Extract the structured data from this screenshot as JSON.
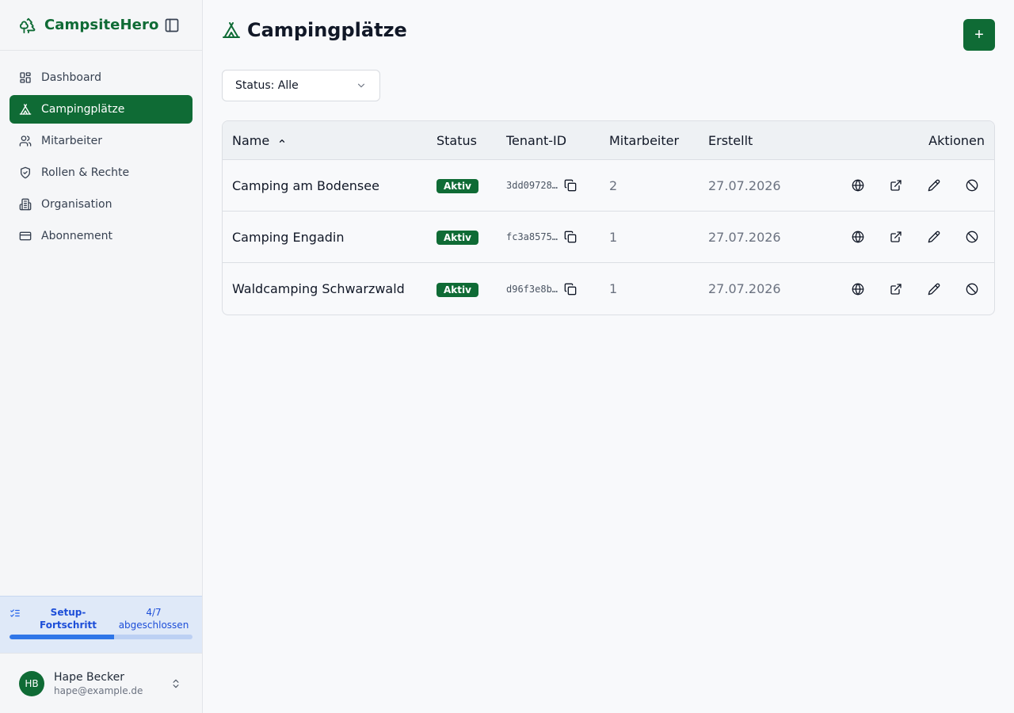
{
  "brand": {
    "name": "CampsiteHero"
  },
  "nav": [
    {
      "label": "Dashboard",
      "icon": "dashboard-icon",
      "active": false
    },
    {
      "label": "Campingplätze",
      "icon": "tent-icon",
      "active": true
    },
    {
      "label": "Mitarbeiter",
      "icon": "users-icon",
      "active": false
    },
    {
      "label": "Rollen & Rechte",
      "icon": "shield-icon",
      "active": false
    },
    {
      "label": "Organisation",
      "icon": "building-icon",
      "active": false
    },
    {
      "label": "Abonnement",
      "icon": "credit-card-icon",
      "active": false
    }
  ],
  "setup": {
    "title": "Setup-Fortschritt",
    "count": "4/7 abgeschlossen",
    "progress": 0.57
  },
  "user": {
    "initials": "HB",
    "name": "Hape Becker",
    "email": "hape@example.de"
  },
  "page": {
    "title": "Campingplätze",
    "add_label": "+"
  },
  "filter": {
    "label": "Status: Alle"
  },
  "table": {
    "headers": {
      "name": "Name",
      "status": "Status",
      "tenant": "Tenant-ID",
      "staff": "Mitarbeiter",
      "created": "Erstellt",
      "actions": "Aktionen"
    },
    "rows": [
      {
        "name": "Camping am Bodensee",
        "status": "Aktiv",
        "tenant": "3dd09728…",
        "staff": "2",
        "created": "27.07.2026"
      },
      {
        "name": "Camping Engadin",
        "status": "Aktiv",
        "tenant": "fc3a8575…",
        "staff": "1",
        "created": "27.07.2026"
      },
      {
        "name": "Waldcamping Schwarzwald",
        "status": "Aktiv",
        "tenant": "d96f3e8b…",
        "staff": "1",
        "created": "27.07.2026"
      }
    ]
  },
  "colors": {
    "brand": "#0f6b35",
    "setup_bg": "#dfe9f8",
    "setup_accent": "#2f76e8"
  }
}
